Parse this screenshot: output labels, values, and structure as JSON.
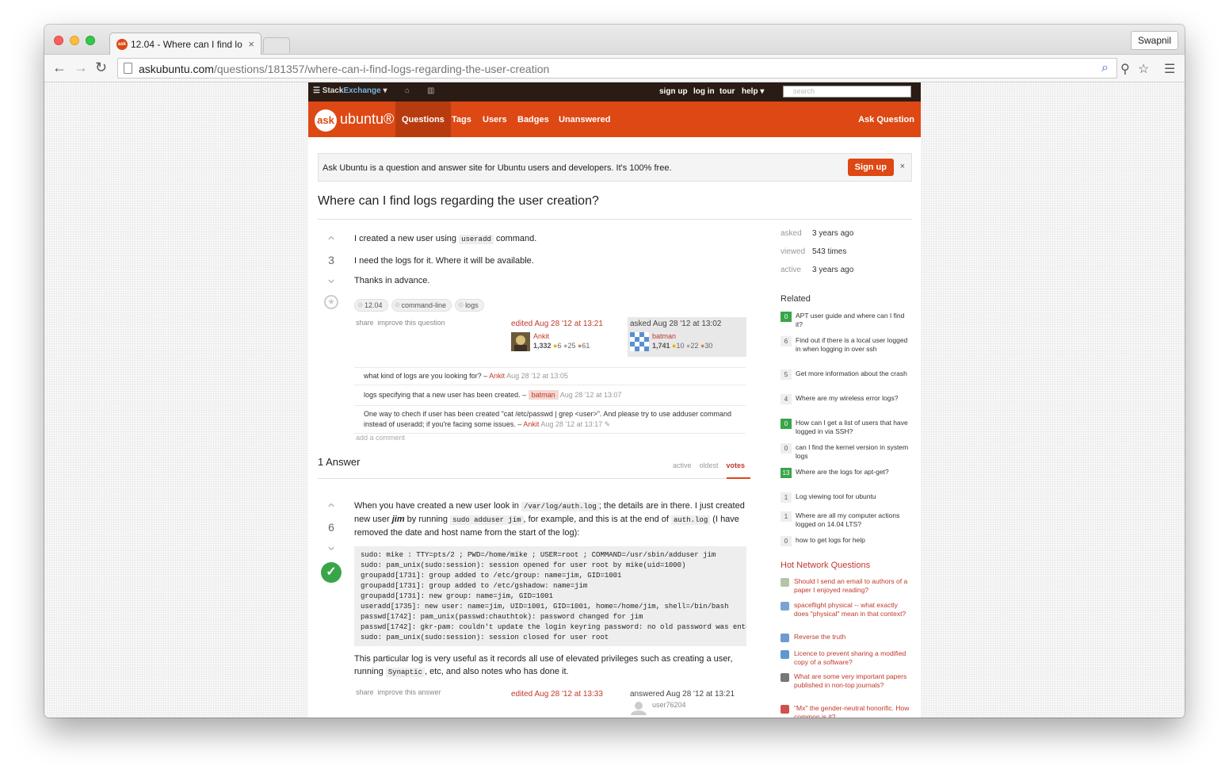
{
  "browser": {
    "tab_title": "12.04 - Where can I find lo",
    "profile_name": "Swapnil",
    "url_host": "askubuntu.com",
    "url_path": "/questions/181357/where-can-i-find-logs-regarding-the-user-creation"
  },
  "topbar": {
    "brand_a": "Stack",
    "brand_b": "Exchange",
    "links": [
      "sign up",
      "log in",
      "tour",
      "help ▾"
    ],
    "search_placeholder": "search"
  },
  "header": {
    "logo_ask": "ask",
    "logo_word": "ubuntu®",
    "nav": [
      "Questions",
      "Tags",
      "Users",
      "Badges",
      "Unanswered"
    ],
    "ask_button": "Ask Question"
  },
  "notice": {
    "text": "Ask Ubuntu is a question and answer site for Ubuntu users and developers. It's 100% free.",
    "signup": "Sign up",
    "close": "×"
  },
  "question": {
    "title": "Where can I find logs regarding the user creation?",
    "votes": "3",
    "p1_a": "I created a new user using ",
    "p1_code": "useradd",
    "p1_b": " command.",
    "p2": "I need the logs for it. Where it will be available.",
    "p3": "Thanks in advance.",
    "tags": [
      "12.04",
      "command-line",
      "logs"
    ],
    "share": "share",
    "improve": "improve this question",
    "editor": {
      "action": "edited Aug 28 '12 at 13:21",
      "name": "Ankit",
      "rep": "1,332",
      "gold": "6",
      "silver": "25",
      "bronze": "61"
    },
    "owner": {
      "action": "asked Aug 28 '12 at 13:02",
      "name": "batman",
      "rep": "1,741",
      "gold": "10",
      "silver": "22",
      "bronze": "30"
    },
    "comments": [
      {
        "text": "what kind of logs are you looking for? – ",
        "user": "Ankit",
        "date": "Aug 28 '12 at 13:05"
      },
      {
        "text": "logs specifying that a new user has been created. – ",
        "user": "batman",
        "date": "Aug 28 '12 at 13:07"
      },
      {
        "text": "One way to chech if user has been created \"cat /etc/passwd | grep <user>\". And please try to use adduser command instead of useradd; if you're facing some issues. – ",
        "user": "Ankit",
        "date": "Aug 28 '12 at 13:17 ✎"
      }
    ],
    "add_comment": "add a comment"
  },
  "answers": {
    "heading": "1 Answer",
    "sort": [
      "active",
      "oldest",
      "votes"
    ]
  },
  "answer": {
    "votes": "6",
    "p1_a": "When you have created a new user look in ",
    "p1_code1": "/var/log/auth.log",
    "p1_b": "; the details are in there. I just created new user ",
    "p1_em": "jim",
    "p1_c": " by running ",
    "p1_code2": "sudo adduser jim",
    "p1_d": ", for example, and this is at the end of ",
    "p1_code3": "auth.log",
    "p1_e": " (I have removed the date and host name from the start of the log):",
    "code": "sudo: mike : TTY=pts/2 ; PWD=/home/mike ; USER=root ; COMMAND=/usr/sbin/adduser jim\nsudo: pam_unix(sudo:session): session opened for user root by mike(uid=1000)\ngroupadd[1731]: group added to /etc/group: name=jim, GID=1001\ngroupadd[1731]: group added to /etc/gshadow: name=jim\ngroupadd[1731]: new group: name=jim, GID=1001\nuseradd[1735]: new user: name=jim, UID=1001, GID=1001, home=/home/jim, shell=/bin/bash\npasswd[1742]: pam_unix(passwd:chauthtok): password changed for jim\npasswd[1742]: gkr-pam: couldn't update the login keyring password: no old password was ente\nsudo: pam_unix(sudo:session): session closed for user root",
    "p2_a": "This particular log is very useful as it records all use of elevated privileges such as creating a user, running ",
    "p2_code": "Synaptic",
    "p2_b": ", etc, and also notes who has done it.",
    "share": "share",
    "improve": "improve this answer",
    "edited": "edited Aug 28 '12 at 13:33",
    "answered": "answered Aug 28 '12 at 13:21",
    "answerer": "user76204"
  },
  "sidebar": {
    "stats": [
      {
        "label": "asked",
        "value": "3 years ago"
      },
      {
        "label": "viewed",
        "value": "543 times"
      },
      {
        "label": "active",
        "value": "3 years ago"
      }
    ],
    "related_heading": "Related",
    "related": [
      {
        "score": "0",
        "accepted": true,
        "title": "APT user guide and where can I find it?"
      },
      {
        "score": "6",
        "accepted": false,
        "title": "Find out if there is a local user logged in when logging in over ssh"
      },
      {
        "score": "5",
        "accepted": false,
        "title": "Get more information about the crash"
      },
      {
        "score": "4",
        "accepted": false,
        "title": "Where are my wireless error logs?"
      },
      {
        "score": "0",
        "accepted": true,
        "title": "How can I get a list of users that have logged in via SSH?"
      },
      {
        "score": "0",
        "accepted": false,
        "title": "can I find the kernel version in system logs"
      },
      {
        "score": "13",
        "accepted": true,
        "title": "Where are the logs for apt-get?"
      },
      {
        "score": "1",
        "accepted": false,
        "title": "Log viewing tool for ubuntu"
      },
      {
        "score": "1",
        "accepted": false,
        "title": "Where are all my computer actions logged on 14.04 LTS?"
      },
      {
        "score": "0",
        "accepted": false,
        "title": "how to get logs for help"
      }
    ],
    "hot_heading": "Hot Network Questions",
    "hot": [
      {
        "title": "Should I send an email to authors of a paper I enjoyed reading?",
        "color": "#b5c4a8"
      },
      {
        "title": "spaceflight physical -- what exactly does \"physical\" mean in that context?",
        "color": "#7aa3d4"
      },
      {
        "title": "Reverse the truth",
        "color": "#6e9ad0"
      },
      {
        "title": "Licence to prevent sharing a modified copy of a software?",
        "color": "#5f98cf"
      },
      {
        "title": "What are some very important papers published in non-top journals?",
        "color": "#777777"
      },
      {
        "title": "\"Mx\" the gender-neutral honorific. How common is it?",
        "color": "#d05050"
      }
    ]
  }
}
